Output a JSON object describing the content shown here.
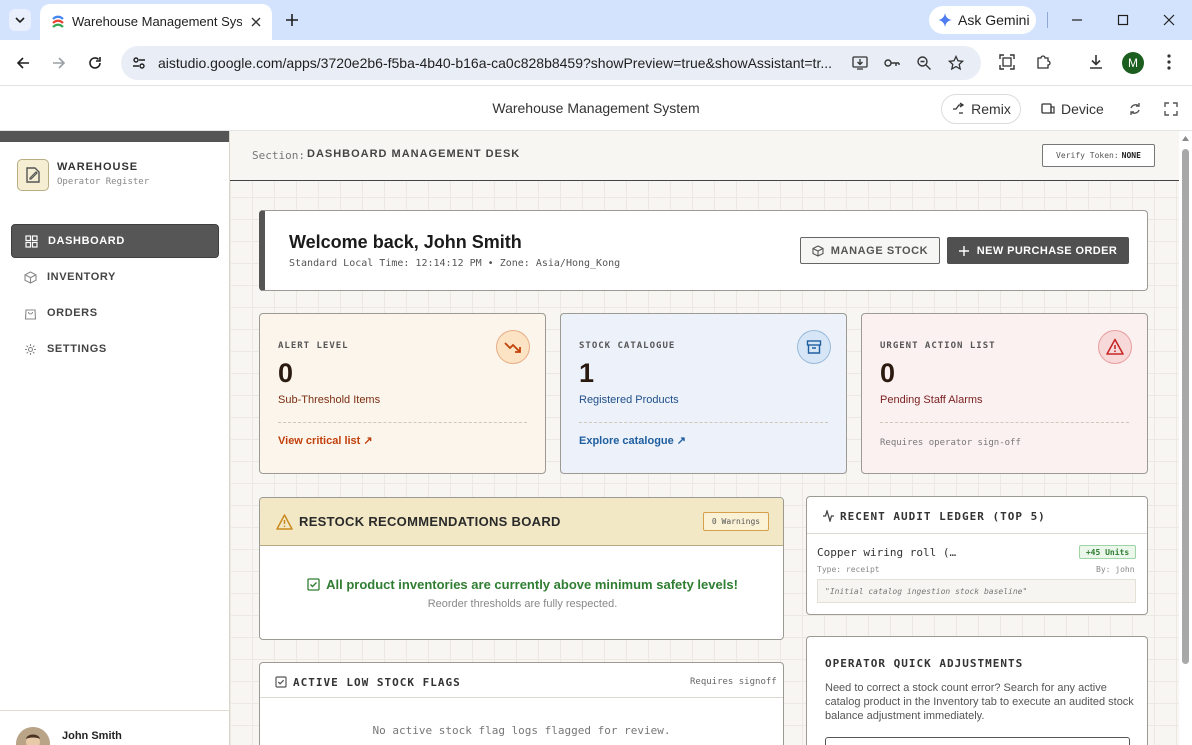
{
  "browser": {
    "tab_title": "Warehouse Management System",
    "ask_gemini": "Ask Gemini",
    "url": "aistudio.google.com/apps/3720e2b6-f5ba-4b40-b16a-ca0c828b8459?showPreview=true&showAssistant=tr...",
    "profile_initial": "M"
  },
  "app_header": {
    "title": "Warehouse Management System",
    "remix": "Remix",
    "device": "Device"
  },
  "sidebar": {
    "brand_name": "WAREHOUSE",
    "brand_sub": "Operator Register",
    "items": [
      {
        "label": "DASHBOARD",
        "icon": "grid-icon",
        "active": true
      },
      {
        "label": "INVENTORY",
        "icon": "box-icon",
        "active": false
      },
      {
        "label": "ORDERS",
        "icon": "bag-icon",
        "active": false
      },
      {
        "label": "SETTINGS",
        "icon": "gear-icon",
        "active": false
      }
    ],
    "user_name": "John Smith"
  },
  "topbar": {
    "section_label": "Section:",
    "section_value": "DASHBOARD MANAGEMENT DESK",
    "verify_label": "Verify Token:",
    "verify_value": "NONE"
  },
  "welcome": {
    "title": "Welcome back, John Smith",
    "subtitle": "Standard Local Time: 12:14:12 PM • Zone: Asia/Hong_Kong",
    "manage_stock": "MANAGE STOCK",
    "new_po": "NEW PURCHASE ORDER"
  },
  "stats": [
    {
      "label": "ALERT LEVEL",
      "value": "0",
      "desc": "Sub-Threshold Items",
      "footer": "View critical list ↗",
      "icon": "trending-down-icon",
      "bg": "#fbf5ec",
      "accent": "#c2410c",
      "desc_color": "#7a2e12",
      "icon_bg": "#fbe3c4"
    },
    {
      "label": "STOCK CATALOGUE",
      "value": "1",
      "desc": "Registered Products",
      "footer": "Explore catalogue ↗",
      "icon": "archive-icon",
      "bg": "#edf1fa",
      "accent": "#1f5fa0",
      "desc_color": "#1f4f8a",
      "icon_bg": "#d6e6f7"
    },
    {
      "label": "URGENT ACTION LIST",
      "value": "0",
      "desc": "Pending Staff Alarms",
      "footer": "Requires operator sign-off",
      "icon": "alert-triangle-icon",
      "bg": "#fcf1f1",
      "accent": "#c62828",
      "desc_color": "#7a1f1f",
      "icon_bg": "#f8d9d9"
    }
  ],
  "restock": {
    "title": "RESTOCK RECOMMENDATIONS BOARD",
    "badge": "0 Warnings",
    "ok_message": "All product inventories are currently above minimum safety levels!",
    "sub_message": "Reorder thresholds are fully respected."
  },
  "flags": {
    "title": "ACTIVE LOW STOCK FLAGS",
    "requires": "Requires signoff",
    "empty": "No active stock flag logs flagged for review."
  },
  "audit": {
    "title": "RECENT AUDIT LEDGER (TOP 5)",
    "entries": [
      {
        "item": "Copper wiring roll (…",
        "qty": "+45 Units",
        "type": "Type: receipt",
        "by": "By: john",
        "note": "\"Initial catalog ingestion stock baseline\""
      }
    ]
  },
  "quick": {
    "title": "OPERATOR QUICK ADJUSTMENTS",
    "text": "Need to correct a stock count error? Search for any active catalog product in the Inventory tab to execute an audited stock balance adjustment immediately."
  },
  "colors": {
    "sidebar_active": "#565656",
    "success": "#2f7d32",
    "warning_band": "#f2e8c6"
  }
}
